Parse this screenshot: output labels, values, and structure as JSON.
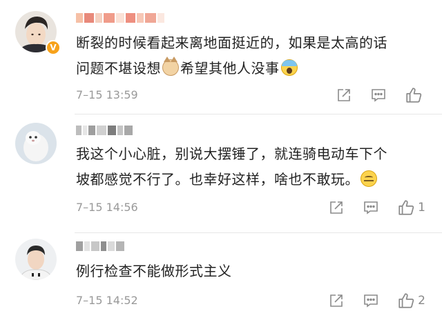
{
  "comments": [
    {
      "username_visible": false,
      "verified": true,
      "lines": [
        "断裂的时候看起来离地面挺近的，如果是太高的话",
        "问题不堪设想",
        "希望其他人没事"
      ],
      "emojis": [
        "cat-face-icon",
        "screaming-face-icon"
      ],
      "time": "7–15 13:59",
      "like_count": ""
    },
    {
      "username_visible": false,
      "verified": false,
      "lines": [
        "我这个小心脏，别说大摆锤了，就连骑电动车下个",
        "坡都感觉不行了。也幸好这样，啥也不敢玩。"
      ],
      "emojis": [
        "zipper-mouth-face-icon"
      ],
      "time": "7–15 14:56",
      "like_count": "1"
    },
    {
      "username_visible": false,
      "verified": false,
      "lines": [
        "例行检查不能做形式主义"
      ],
      "emojis": [],
      "time": "7–15 14:52",
      "like_count": "2"
    }
  ],
  "icons": {
    "share": "share-icon",
    "reply": "comment-icon",
    "like": "thumbs-up-icon"
  },
  "verified_badge": "V"
}
